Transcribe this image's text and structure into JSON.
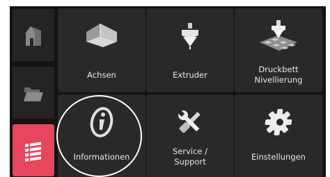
{
  "sidebar": {
    "items": [
      {
        "icon": "home-icon",
        "active": false
      },
      {
        "icon": "folder-icon",
        "active": false
      },
      {
        "icon": "menu-list-icon",
        "active": true
      }
    ],
    "active_color": "#e8465e"
  },
  "tiles": [
    {
      "label": "Achsen",
      "icon": "axes-icon"
    },
    {
      "label": "Extruder",
      "icon": "extruder-icon"
    },
    {
      "label": "Druckbett\nNivellierung",
      "icon": "bed-leveling-icon"
    },
    {
      "label": "Informationen",
      "icon": "info-icon"
    },
    {
      "label": "Service /\nSupport",
      "icon": "wrench-screwdriver-icon"
    },
    {
      "label": "Einstellungen",
      "icon": "gear-icon"
    }
  ],
  "highlight": {
    "target": "Informationen",
    "color": "#ffffff"
  }
}
